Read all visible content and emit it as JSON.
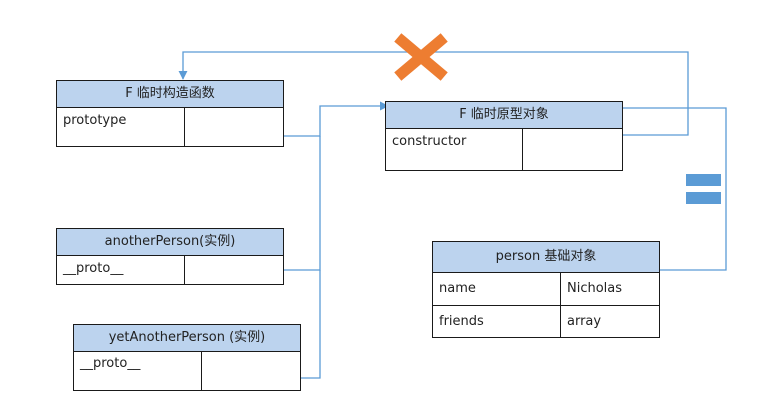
{
  "ctor": {
    "title": "F 临时构造函数",
    "key": "prototype",
    "value": ""
  },
  "proto": {
    "title": "F 临时原型对象",
    "key": "constructor",
    "value": ""
  },
  "another": {
    "title": "anotherPerson(实例)",
    "key": "__proto__",
    "value": ""
  },
  "yet": {
    "title": "yetAnotherPerson (实例)",
    "key": "__proto__",
    "value": ""
  },
  "person": {
    "title": "person 基础对象",
    "rows": [
      {
        "key": "name",
        "value": "Nicholas"
      },
      {
        "key": "friends",
        "value": "array"
      }
    ]
  },
  "colors": {
    "header": "#bcd3ee",
    "arrow": "#5b9bd5",
    "cross": "#ed7d31",
    "equals": "#5b9bd5"
  }
}
